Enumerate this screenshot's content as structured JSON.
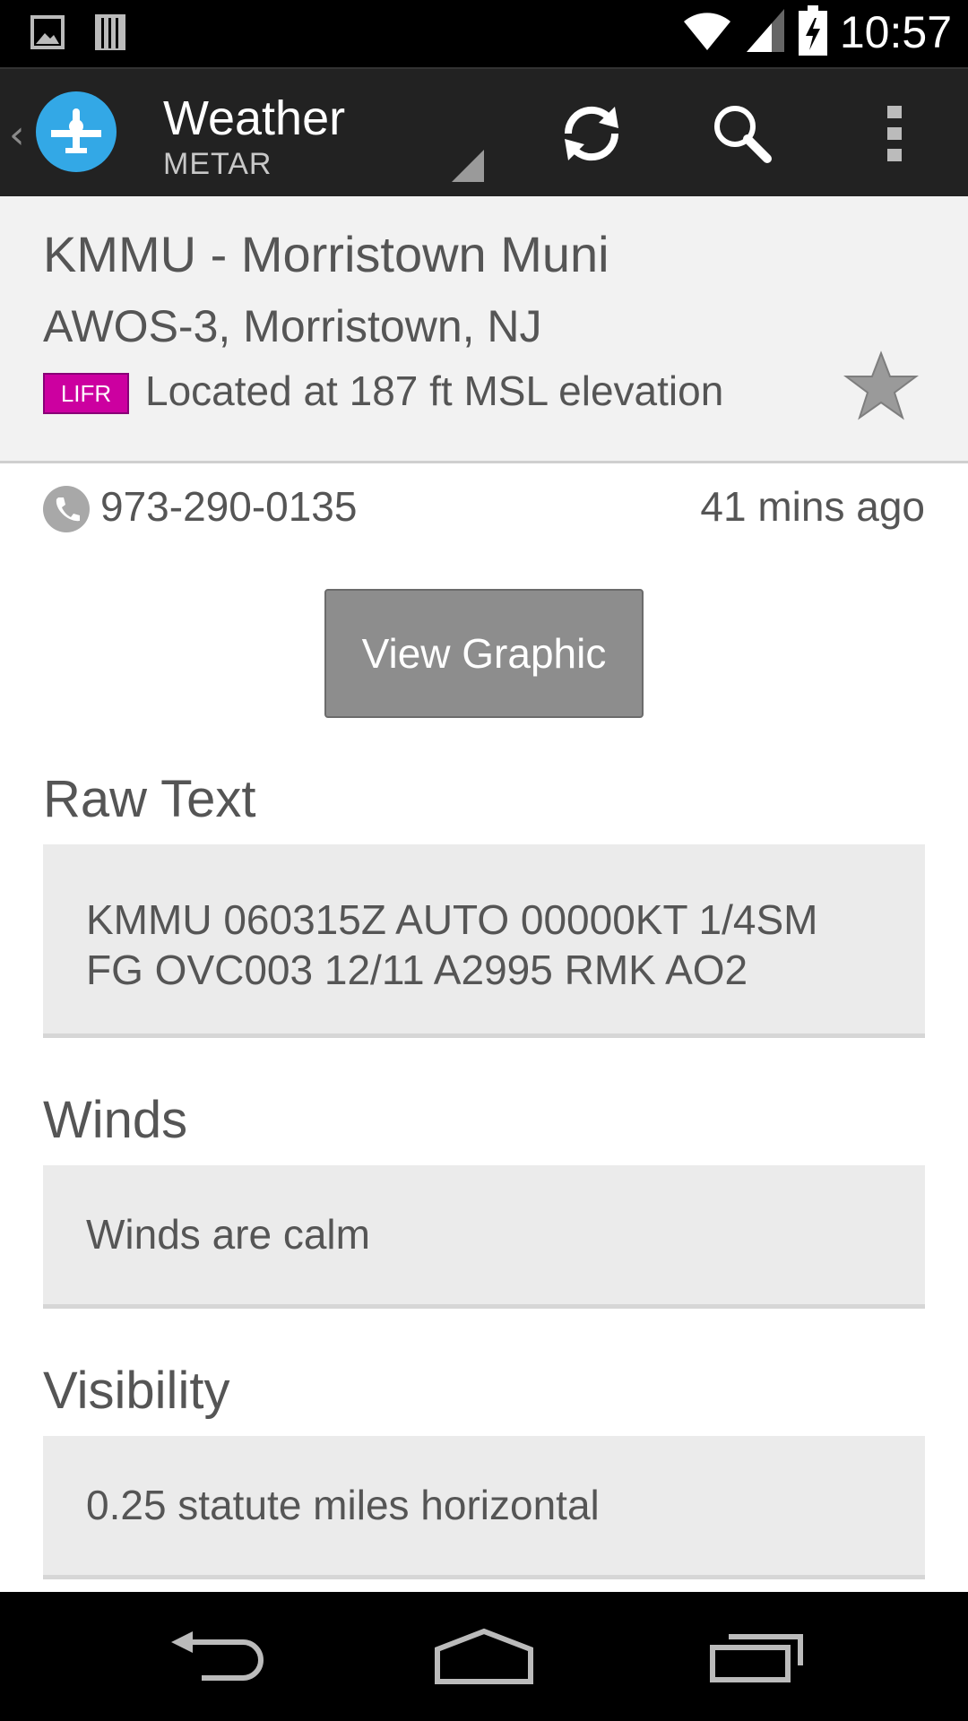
{
  "status_bar": {
    "time": "10:57",
    "icons": [
      "image-notification-icon",
      "storage-notification-icon",
      "wifi-icon",
      "cell-signal-icon",
      "battery-charging-icon"
    ]
  },
  "action_bar": {
    "title": "Weather",
    "subtitle": "METAR",
    "app_icon": "airplane-icon",
    "actions": [
      "refresh-icon",
      "search-icon",
      "overflow-menu-icon"
    ]
  },
  "airport": {
    "name": "KMMU - Morristown Muni",
    "location": "AWOS-3, Morristown, NJ",
    "flight_category": "LIFR",
    "flight_category_color": "#cc00a0",
    "elevation_text": "Located at 187 ft MSL elevation",
    "favorite_icon": "star-icon"
  },
  "contact": {
    "phone": "973-290-0135",
    "age": "41 mins ago"
  },
  "view_graphic_label": "View Graphic",
  "sections": {
    "raw_text": {
      "title": "Raw Text",
      "line1": "KMMU 060315Z AUTO 00000KT 1/4SM",
      "line2": "FG OVC003 12/11 A2995 RMK AO2"
    },
    "winds": {
      "title": "Winds",
      "value": "Winds are calm"
    },
    "visibility": {
      "title": "Visibility",
      "value": "0.25 statute miles horizontal"
    }
  },
  "nav_bar": {
    "buttons": [
      "back-icon",
      "home-icon",
      "recent-apps-icon"
    ]
  }
}
